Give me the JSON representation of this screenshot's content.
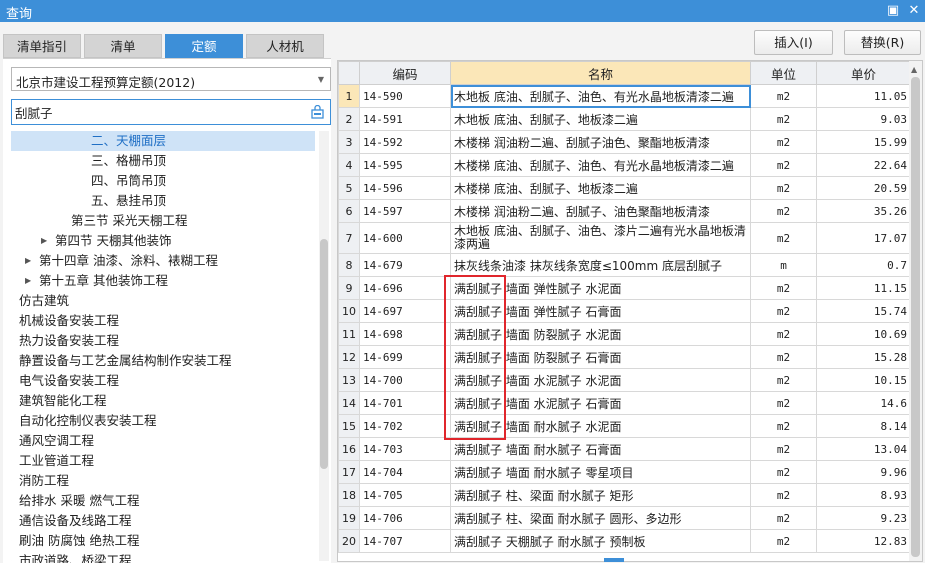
{
  "window": {
    "title": "查询"
  },
  "colors": {
    "accent": "#3d8fd8",
    "selected_bg": "#cfe3f7",
    "annotation": "#e0262c",
    "header_highlight": "#fbe7b8"
  },
  "tabs": [
    "清单指引",
    "清单",
    "定额",
    "人材机"
  ],
  "active_tab": "定额",
  "actions": {
    "insert": "插入(I)",
    "replace": "替换(R)"
  },
  "combo": {
    "value": "北京市建设工程预算定额(2012)"
  },
  "search": {
    "value": "刮腻子"
  },
  "tree": [
    {
      "label": "二、天棚面层",
      "selected": true
    },
    {
      "label": "三、格栅吊顶"
    },
    {
      "label": "四、吊筒吊顶"
    },
    {
      "label": "五、悬挂吊顶"
    },
    {
      "label": "第三节 采光天棚工程"
    },
    {
      "label": "第四节 天棚其他装饰",
      "expandable": true
    },
    {
      "label": "第十四章 油漆、涂料、裱糊工程",
      "expandable": true
    },
    {
      "label": "第十五章 其他装饰工程",
      "expandable": true
    },
    {
      "label": "仿古建筑",
      "expandable": true
    },
    {
      "label": "机械设备安装工程",
      "expandable": true
    },
    {
      "label": "热力设备安装工程",
      "expandable": true
    },
    {
      "label": "静置设备与工艺金属结构制作安装工程",
      "expandable": true
    },
    {
      "label": "电气设备安装工程",
      "expandable": true
    },
    {
      "label": "建筑智能化工程",
      "expandable": true
    },
    {
      "label": "自动化控制仪表安装工程",
      "expandable": true
    },
    {
      "label": "通风空调工程",
      "expandable": true
    },
    {
      "label": "工业管道工程",
      "expandable": true
    },
    {
      "label": "消防工程",
      "expandable": true
    },
    {
      "label": "给排水 采暖 燃气工程",
      "expandable": true
    },
    {
      "label": "通信设备及线路工程",
      "expandable": true
    },
    {
      "label": "刷油 防腐蚀 绝热工程",
      "expandable": true
    },
    {
      "label": "市政道路、桥梁工程",
      "expandable": true
    }
  ],
  "grid": {
    "columns": [
      "",
      "编码",
      "名称",
      "单位",
      "单价"
    ],
    "rows": [
      {
        "n": "1",
        "code": "14-590",
        "name": "木地板 底油、刮腻子、油色、有光水晶地板清漆二遍",
        "unit": "m2",
        "price": "11.05"
      },
      {
        "n": "2",
        "code": "14-591",
        "name": "木地板 底油、刮腻子、地板漆二遍",
        "unit": "m2",
        "price": "9.03"
      },
      {
        "n": "3",
        "code": "14-592",
        "name": "木楼梯 润油粉二遍、刮腻子油色、聚酯地板清漆",
        "unit": "m2",
        "price": "15.99"
      },
      {
        "n": "4",
        "code": "14-595",
        "name": "木楼梯 底油、刮腻子、油色、有光水晶地板清漆二遍",
        "unit": "m2",
        "price": "22.64"
      },
      {
        "n": "5",
        "code": "14-596",
        "name": "木楼梯 底油、刮腻子、地板漆二遍",
        "unit": "m2",
        "price": "20.59"
      },
      {
        "n": "6",
        "code": "14-597",
        "name": "木楼梯 润油粉二遍、刮腻子、油色聚酯地板清漆",
        "unit": "m2",
        "price": "35.26"
      },
      {
        "n": "7",
        "code": "14-600",
        "name": "木地板 底油、刮腻子、油色、漆片二遍有光水晶地板清漆两遍",
        "unit": "m2",
        "price": "17.07"
      },
      {
        "n": "8",
        "code": "14-679",
        "name": "抹灰线条油漆 抹灰线条宽度≤100mm 底层刮腻子",
        "unit": "m",
        "price": "0.7"
      },
      {
        "n": "9",
        "code": "14-696",
        "name": "满刮腻子 墙面 弹性腻子 水泥面",
        "unit": "m2",
        "price": "11.15"
      },
      {
        "n": "10",
        "code": "14-697",
        "name": "满刮腻子 墙面 弹性腻子 石膏面",
        "unit": "m2",
        "price": "15.74"
      },
      {
        "n": "11",
        "code": "14-698",
        "name": "满刮腻子 墙面 防裂腻子 水泥面",
        "unit": "m2",
        "price": "10.69"
      },
      {
        "n": "12",
        "code": "14-699",
        "name": "满刮腻子 墙面 防裂腻子 石膏面",
        "unit": "m2",
        "price": "15.28"
      },
      {
        "n": "13",
        "code": "14-700",
        "name": "满刮腻子 墙面 水泥腻子 水泥面",
        "unit": "m2",
        "price": "10.15"
      },
      {
        "n": "14",
        "code": "14-701",
        "name": "满刮腻子 墙面 水泥腻子 石膏面",
        "unit": "m2",
        "price": "14.6"
      },
      {
        "n": "15",
        "code": "14-702",
        "name": "满刮腻子 墙面 耐水腻子 水泥面",
        "unit": "m2",
        "price": "8.14"
      },
      {
        "n": "16",
        "code": "14-703",
        "name": "满刮腻子 墙面 耐水腻子 石膏面",
        "unit": "m2",
        "price": "13.04"
      },
      {
        "n": "17",
        "code": "14-704",
        "name": "满刮腻子 墙面 耐水腻子 零星项目",
        "unit": "m2",
        "price": "9.96"
      },
      {
        "n": "18",
        "code": "14-705",
        "name": "满刮腻子 柱、梁面 耐水腻子 矩形",
        "unit": "m2",
        "price": "8.93"
      },
      {
        "n": "19",
        "code": "14-706",
        "name": "满刮腻子 柱、梁面 耐水腻子 圆形、多边形",
        "unit": "m2",
        "price": "9.23"
      },
      {
        "n": "20",
        "code": "14-707",
        "name": "满刮腻子 天棚腻子 耐水腻子 预制板",
        "unit": "m2",
        "price": "12.83"
      }
    ]
  }
}
